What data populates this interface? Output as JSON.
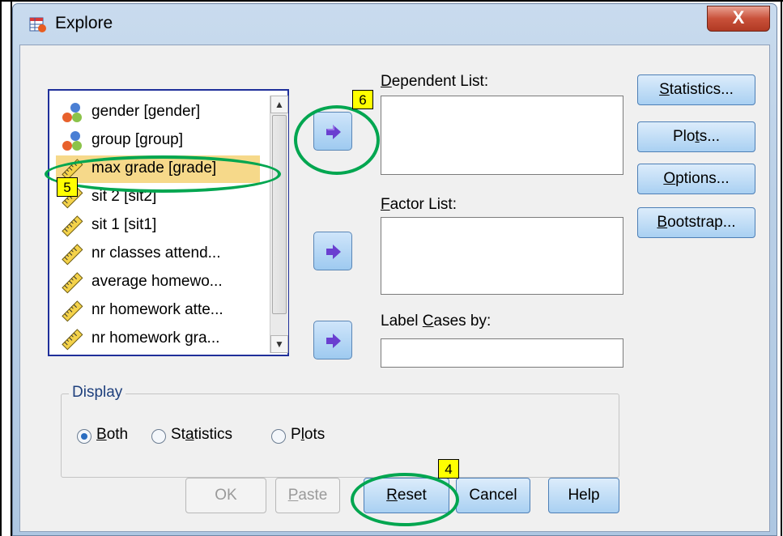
{
  "window": {
    "title": "Explore",
    "close_label": "X"
  },
  "variables": [
    {
      "name": "gender [gender]",
      "type": "nominal-icon"
    },
    {
      "name": "group [group]",
      "type": "nominal-icon"
    },
    {
      "name": "max grade [grade]",
      "type": "scale-icon",
      "selected": true
    },
    {
      "name": "sit 2 [sit2]",
      "type": "scale-icon"
    },
    {
      "name": "sit 1 [sit1]",
      "type": "scale-icon"
    },
    {
      "name": "nr classes attend...",
      "type": "scale-icon"
    },
    {
      "name": "average homewo...",
      "type": "scale-icon"
    },
    {
      "name": "nr homework atte...",
      "type": "scale-icon"
    },
    {
      "name": "nr homework gra...",
      "type": "scale-icon"
    }
  ],
  "fields": {
    "dependent_label": [
      "",
      "D",
      "ependent List:"
    ],
    "factor_label": [
      "",
      "F",
      "actor List:"
    ],
    "label_cases_label": [
      "Label ",
      "C",
      "ases by:"
    ]
  },
  "side_buttons": [
    {
      "pre": "",
      "key": "S",
      "post": "tatistics..."
    },
    {
      "pre": "Plo",
      "key": "t",
      "post": "s..."
    },
    {
      "pre": "",
      "key": "O",
      "post": "ptions..."
    },
    {
      "pre": "",
      "key": "B",
      "post": "ootstrap..."
    }
  ],
  "display": {
    "legend": "Display",
    "options": [
      {
        "pre": "",
        "key": "B",
        "post": "oth",
        "selected": true
      },
      {
        "pre": "St",
        "key": "a",
        "post": "tistics",
        "selected": false
      },
      {
        "pre": "P",
        "key": "l",
        "post": "ots",
        "selected": false
      }
    ]
  },
  "bottom_buttons": {
    "ok": "OK",
    "paste": {
      "pre": "",
      "key": "P",
      "post": "aste"
    },
    "reset": {
      "pre": "",
      "key": "R",
      "post": "eset"
    },
    "cancel": "Cancel",
    "help": "Help"
  },
  "annotations": {
    "step4": "4",
    "step5": "5",
    "step6": "6"
  },
  "colors": {
    "highlight": "#00a650",
    "badge": "#ffff00",
    "selection": "#f6d98a"
  }
}
